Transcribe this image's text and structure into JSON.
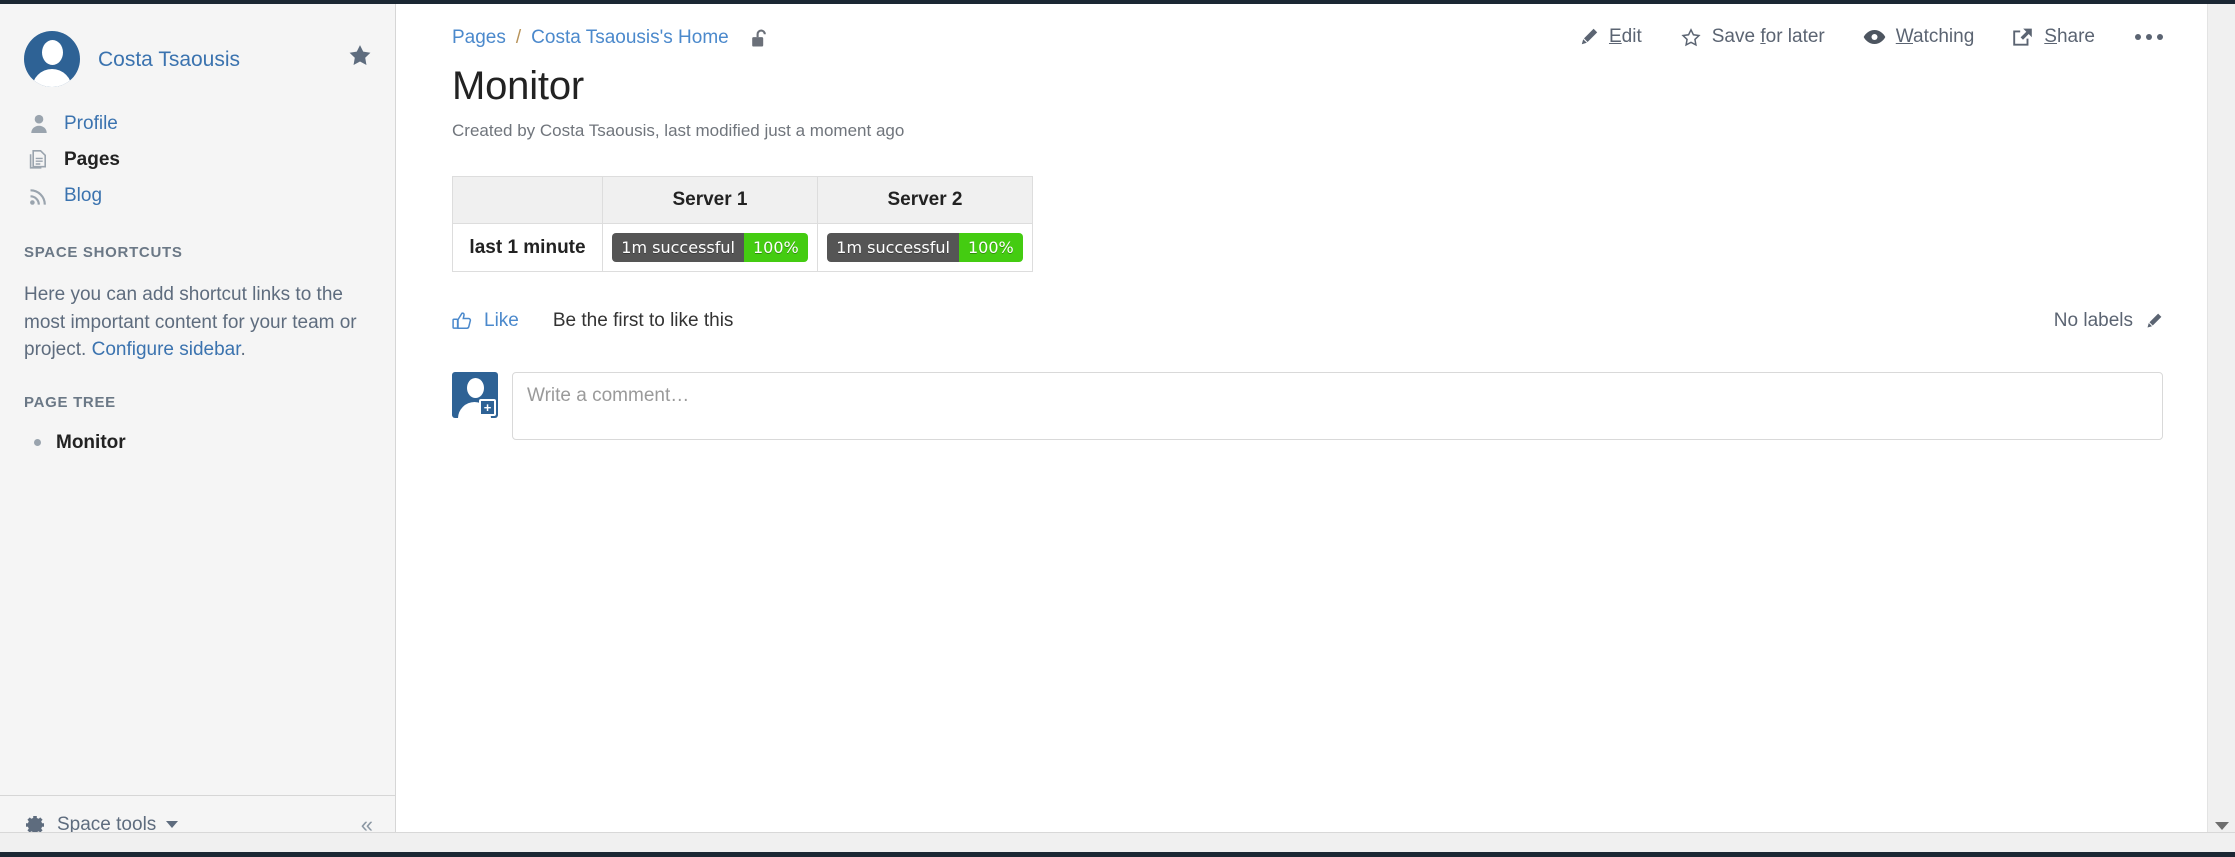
{
  "sidebar": {
    "user": {
      "name": "Costa Tsaousis",
      "avatar_icon": "user-avatar-round"
    },
    "star_icon": "star-filled-icon",
    "nav": [
      {
        "label": "Profile",
        "icon": "person-icon",
        "active": false
      },
      {
        "label": "Pages",
        "icon": "pages-icon",
        "active": true
      },
      {
        "label": "Blog",
        "icon": "rss-icon",
        "active": false
      }
    ],
    "space_shortcuts": {
      "title": "SPACE SHORTCUTS",
      "text_before": "Here you can add shortcut links to the most important content for your team or project. ",
      "link": "Configure sidebar",
      "text_after": "."
    },
    "page_tree": {
      "title": "PAGE TREE",
      "items": [
        {
          "label": "Monitor"
        }
      ]
    },
    "footer": {
      "space_tools_label": "Space tools",
      "gear_icon": "gear-icon",
      "caret_icon": "caret-down-icon",
      "collapse_icon": "double-chevron-left-icon",
      "collapse_glyph": "«"
    }
  },
  "header": {
    "breadcrumb": [
      {
        "label": "Pages"
      },
      {
        "label": "Costa Tsaousis's Home"
      }
    ],
    "breadcrumb_separator": "/",
    "restriction_icon": "unlocked-padlock-icon",
    "title": "Monitor",
    "meta": "Created by Costa Tsaousis, last modified just a moment ago"
  },
  "actions": [
    {
      "id": "edit",
      "icon": "pencil-icon",
      "accesskey": "E",
      "rest": "dit"
    },
    {
      "id": "save-for-later",
      "icon": "star-outline-icon",
      "pre": "Save ",
      "accesskey": "f",
      "rest": "or later"
    },
    {
      "id": "watching",
      "icon": "eye-icon",
      "accesskey": "W",
      "rest": "atching"
    },
    {
      "id": "share",
      "icon": "share-icon",
      "accesskey": "S",
      "rest": "hare"
    }
  ],
  "more_actions_icon": "ellipsis-icon",
  "table": {
    "columns": [
      "",
      "Server 1",
      "Server 2"
    ],
    "rows": [
      {
        "label": "last 1 minute",
        "cells": [
          {
            "left": "1m successful",
            "right": "100%",
            "left_color": "#555555",
            "right_color": "#44cc11"
          },
          {
            "left": "1m successful",
            "right": "100%",
            "left_color": "#555555",
            "right_color": "#44cc11"
          }
        ]
      }
    ]
  },
  "footer_bar": {
    "like_label": "Like",
    "like_icon": "thumbs-up-icon",
    "like_note": "Be the first to like this",
    "labels_text": "No labels",
    "labels_edit_icon": "pencil-icon"
  },
  "comment": {
    "avatar_icon": "user-avatar-square-add",
    "avatar_badge": "+",
    "placeholder": "Write a comment…",
    "value": ""
  },
  "colors": {
    "link": "#4b89cc",
    "sidebar_bg": "#f5f5f5",
    "badge_gray": "#555555",
    "badge_green": "#44cc11",
    "avatar_blue": "#2e6295"
  }
}
